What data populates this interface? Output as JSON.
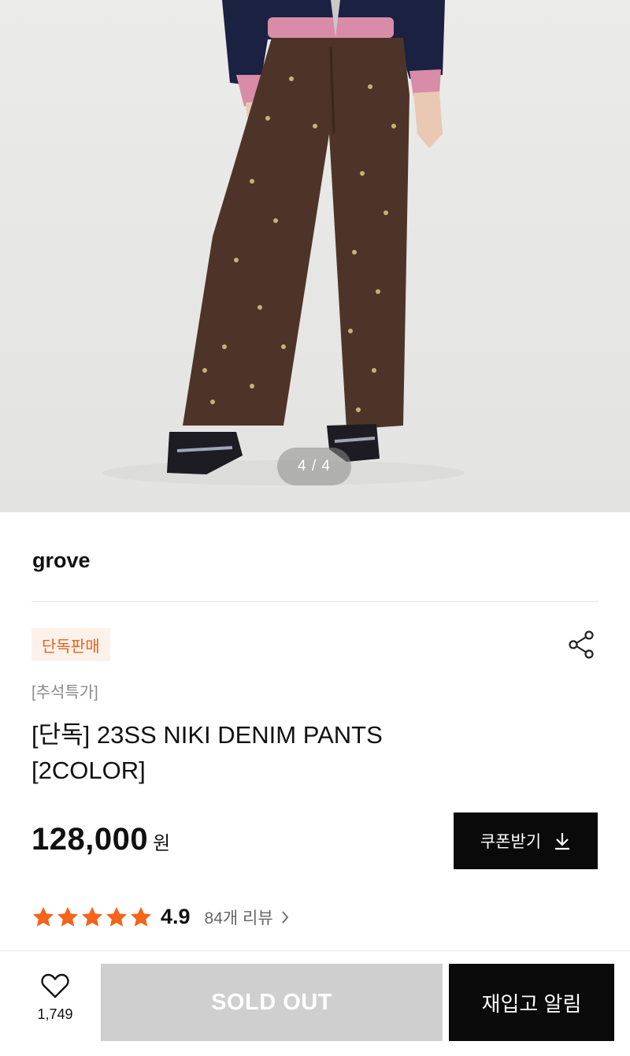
{
  "gallery": {
    "counter": "4 / 4"
  },
  "product": {
    "brand": "grove",
    "badge": "단독판매",
    "category": "[추석특가]",
    "title": "[단독] 23SS NIKI DENIM PANTS [2COLOR]",
    "price": "128,000",
    "price_unit": "원",
    "coupon_label": "쿠폰받기",
    "rating_stars": 5,
    "rating_score": "4.9",
    "review_label": "84개 리뷰",
    "star_color": "#f4641c"
  },
  "icons": {
    "share": "share-icon",
    "download": "download-icon",
    "chevron": "chevron-right-icon",
    "heart": "heart-icon"
  },
  "bottom_bar": {
    "like_count": "1,749",
    "soldout_label": "SOLD OUT",
    "restock_label": "재입고 알림"
  }
}
